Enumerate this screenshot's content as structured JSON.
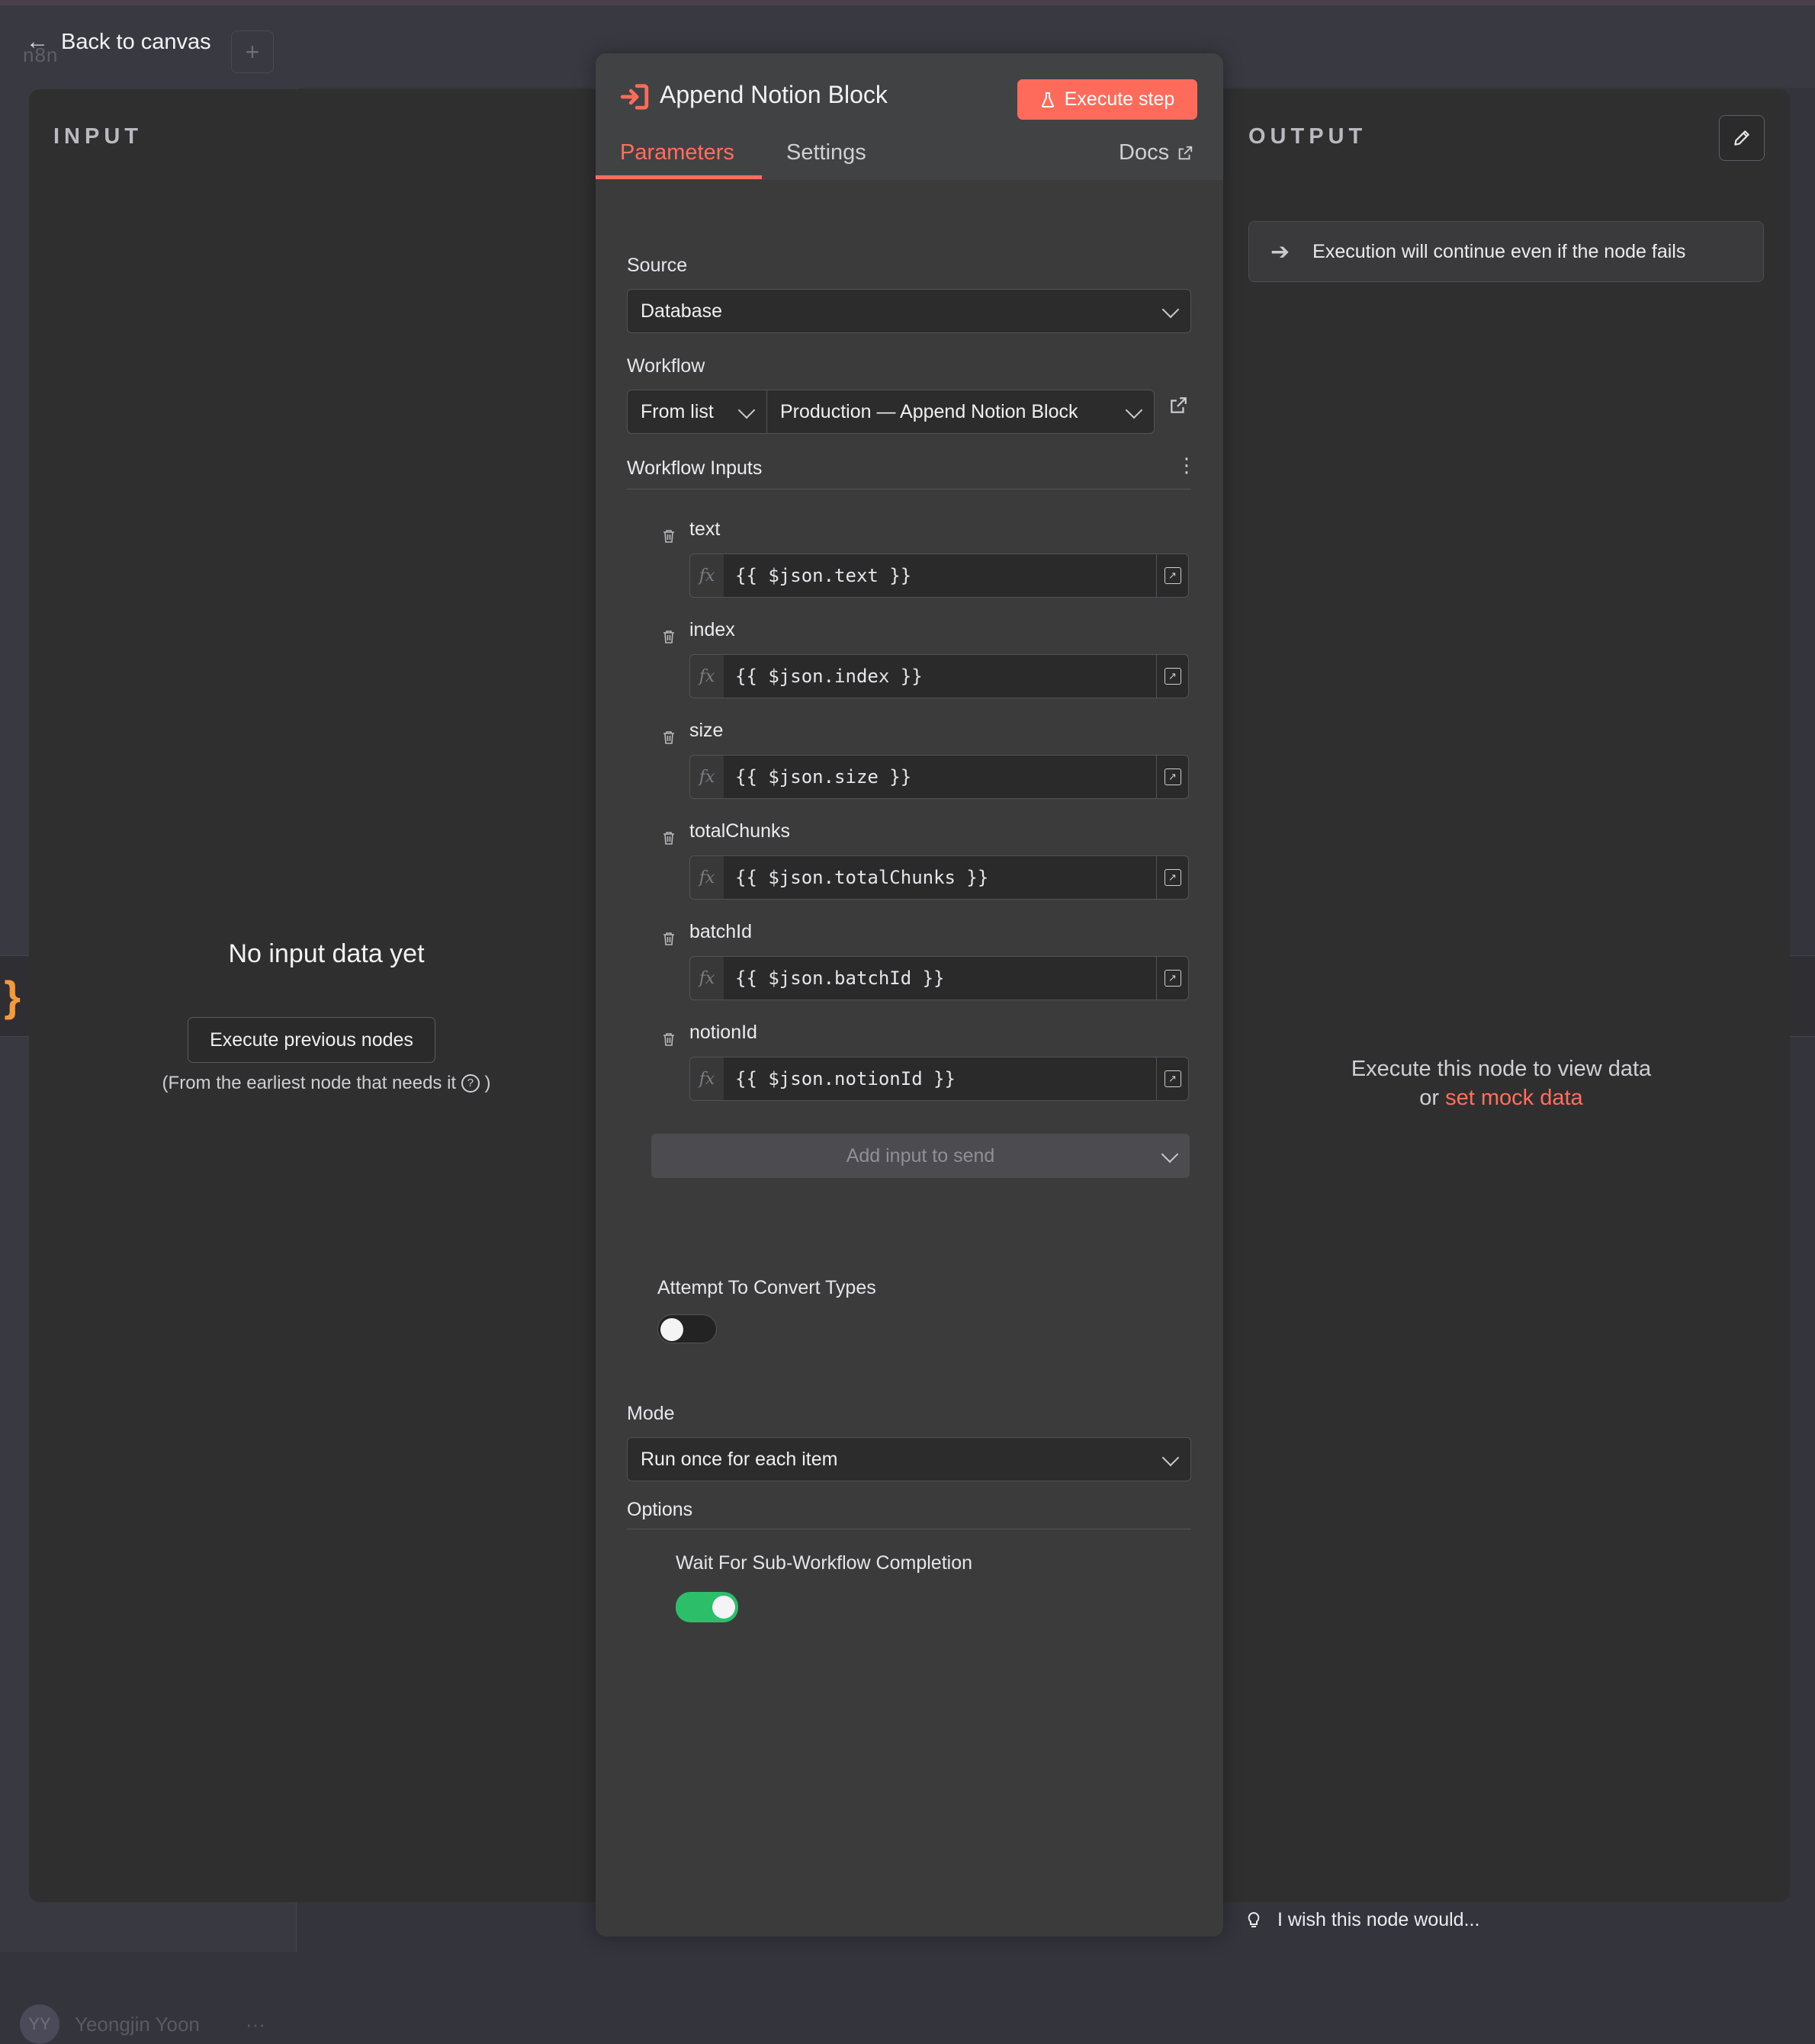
{
  "app": {
    "back_label": "Back to canvas",
    "logo_text": "n8n",
    "plus_label": "+",
    "user_initials": "YY",
    "user_name": "Yeongjin Yoon",
    "user_more": "···"
  },
  "input_panel": {
    "title": "INPUT",
    "empty_title": "No input data yet",
    "execute_previous_label": "Execute previous nodes",
    "earliest_note": "(From the earliest node that needs it",
    "earliest_note_end": ")",
    "help_glyph": "?"
  },
  "output_panel": {
    "title": "OUTPUT",
    "continue_banner": "Execution will continue even if the node fails",
    "execute_hint": "Execute this node to view data",
    "or_text": "or",
    "mock_link": "set mock data"
  },
  "node": {
    "title": "Append Notion Block",
    "execute_step_label": "Execute step",
    "tabs": {
      "parameters": "Parameters",
      "settings": "Settings",
      "docs": "Docs"
    },
    "source": {
      "label": "Source",
      "value": "Database"
    },
    "workflow": {
      "label": "Workflow",
      "mode": "From list",
      "value": "Production — Append Notion Block"
    },
    "workflow_inputs": {
      "title": "Workflow Inputs",
      "fields": [
        {
          "name": "text",
          "expression": "{{ $json.text }}"
        },
        {
          "name": "index",
          "expression": "{{ $json.index }}"
        },
        {
          "name": "size",
          "expression": "{{ $json.size }}"
        },
        {
          "name": "totalChunks",
          "expression": "{{ $json.totalChunks }}"
        },
        {
          "name": "batchId",
          "expression": "{{ $json.batchId }}"
        },
        {
          "name": "notionId",
          "expression": "{{ $json.notionId }}"
        }
      ],
      "fx_label": "fx",
      "add_input_label": "Add input to send"
    },
    "convert_types": {
      "label": "Attempt To Convert Types",
      "enabled": false
    },
    "mode": {
      "label": "Mode",
      "value": "Run once for each item"
    },
    "options": {
      "title": "Options",
      "wait_label": "Wait For Sub-Workflow Completion",
      "wait_enabled": true
    }
  },
  "feedback": {
    "wish_text": "I wish this node would..."
  },
  "colors": {
    "accent": "#ff6b5a",
    "toggle_on": "#2dbe6a",
    "panel_bg": "#2f2f2f",
    "node_bg": "#3b3b3c"
  }
}
